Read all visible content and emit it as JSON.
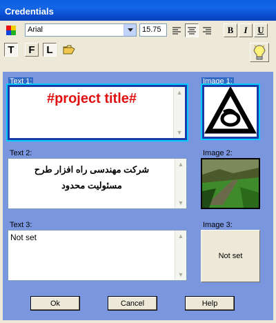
{
  "window": {
    "title": "Credentials"
  },
  "toolbar": {
    "font_name": "Arial",
    "font_size": "15.75",
    "bold_label": "B",
    "italic_label": "I",
    "underline_label": "U",
    "text_btn_label": "T",
    "frame_btn_label": "F",
    "line_btn_label": "L"
  },
  "sections": {
    "text1": {
      "label": "Text 1:",
      "value": "#project title#",
      "color": "#e01010"
    },
    "text2": {
      "label": "Text 2:",
      "line1": "شرکت مهندسی راه افزار طرح",
      "line2": "مسئولیت محدود"
    },
    "text3": {
      "label": "Text 3:",
      "value": "Not set"
    },
    "image1": {
      "label": "Image 1:"
    },
    "image2": {
      "label": "Image 2:"
    },
    "image3": {
      "label": "Image 3:",
      "value": "Not set"
    }
  },
  "buttons": {
    "ok": "Ok",
    "cancel": "Cancel",
    "help": "Help"
  }
}
